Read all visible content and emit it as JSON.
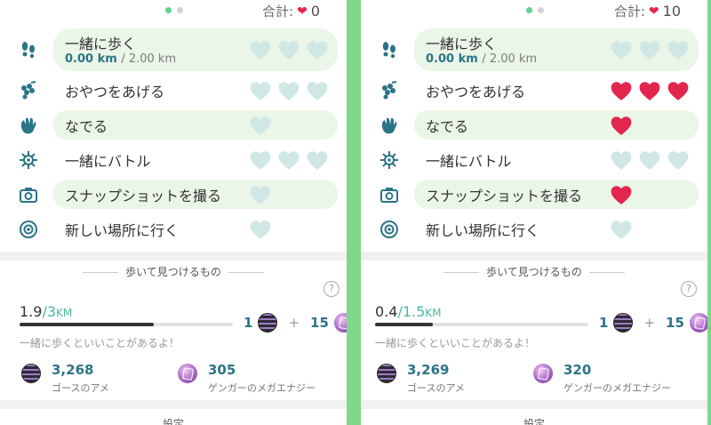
{
  "panels": [
    {
      "total_label": "合計:",
      "total_value": "0",
      "actions": [
        {
          "label": "一緒に歩く",
          "icon": "footprints-icon",
          "distance": "0.00 km",
          "distance_goal": "/ 2.00 km",
          "hearts_total": 3,
          "hearts_filled": 0
        },
        {
          "label": "おやつをあげる",
          "icon": "berries-icon",
          "hearts_total": 3,
          "hearts_filled": 0
        },
        {
          "label": "なでる",
          "icon": "hand-icon",
          "hearts_total": 1,
          "hearts_filled": 0
        },
        {
          "label": "一緒にバトル",
          "icon": "battle-icon",
          "hearts_total": 3,
          "hearts_filled": 0
        },
        {
          "label": "スナップショットを撮る",
          "icon": "camera-icon",
          "hearts_total": 1,
          "hearts_filled": 0
        },
        {
          "label": "新しい場所に行く",
          "icon": "pokestop-icon",
          "hearts_total": 1,
          "hearts_filled": 0
        }
      ],
      "walk_section_title": "歩いて見つけるもの",
      "buddy_distance": "1.9",
      "buddy_goal": "3",
      "buddy_unit": "KM",
      "progress": 0.63,
      "reward_candy": "1",
      "reward_plus": "+",
      "reward_energy": "15",
      "hint": "一緒に歩くといいことがあるよ！",
      "candy_count": "3,268",
      "candy_name": "ゴースのアメ",
      "energy_count": "305",
      "energy_name": "ゲンガーのメガエナジー",
      "settings_title": "設定"
    },
    {
      "total_label": "合計:",
      "total_value": "10",
      "actions": [
        {
          "label": "一緒に歩く",
          "icon": "footprints-icon",
          "distance": "0.00 km",
          "distance_goal": "/ 2.00 km",
          "hearts_total": 3,
          "hearts_filled": 0
        },
        {
          "label": "おやつをあげる",
          "icon": "berries-icon",
          "hearts_total": 3,
          "hearts_filled": 3
        },
        {
          "label": "なでる",
          "icon": "hand-icon",
          "hearts_total": 1,
          "hearts_filled": 1
        },
        {
          "label": "一緒にバトル",
          "icon": "battle-icon",
          "hearts_total": 3,
          "hearts_filled": 0
        },
        {
          "label": "スナップショットを撮る",
          "icon": "camera-icon",
          "hearts_total": 1,
          "hearts_filled": 1
        },
        {
          "label": "新しい場所に行く",
          "icon": "pokestop-icon",
          "hearts_total": 1,
          "hearts_filled": 0
        }
      ],
      "walk_section_title": "歩いて見つけるもの",
      "buddy_distance": "0.4",
      "buddy_goal": "1.5",
      "buddy_unit": "KM",
      "progress": 0.27,
      "reward_candy": "1",
      "reward_plus": "+",
      "reward_energy": "15",
      "hint": "一緒に歩くといいことがあるよ！",
      "candy_count": "3,269",
      "candy_name": "ゴースのアメ",
      "energy_count": "320",
      "energy_name": "ゲンガーのメガエナジー",
      "settings_title": "設定"
    }
  ],
  "colors": {
    "background_green": "#7fd98a",
    "heart_empty": "#cfe8e6",
    "heart_filled": "#e2264d",
    "accent_teal": "#2b7487",
    "distance_goal": "#49b6a3"
  }
}
